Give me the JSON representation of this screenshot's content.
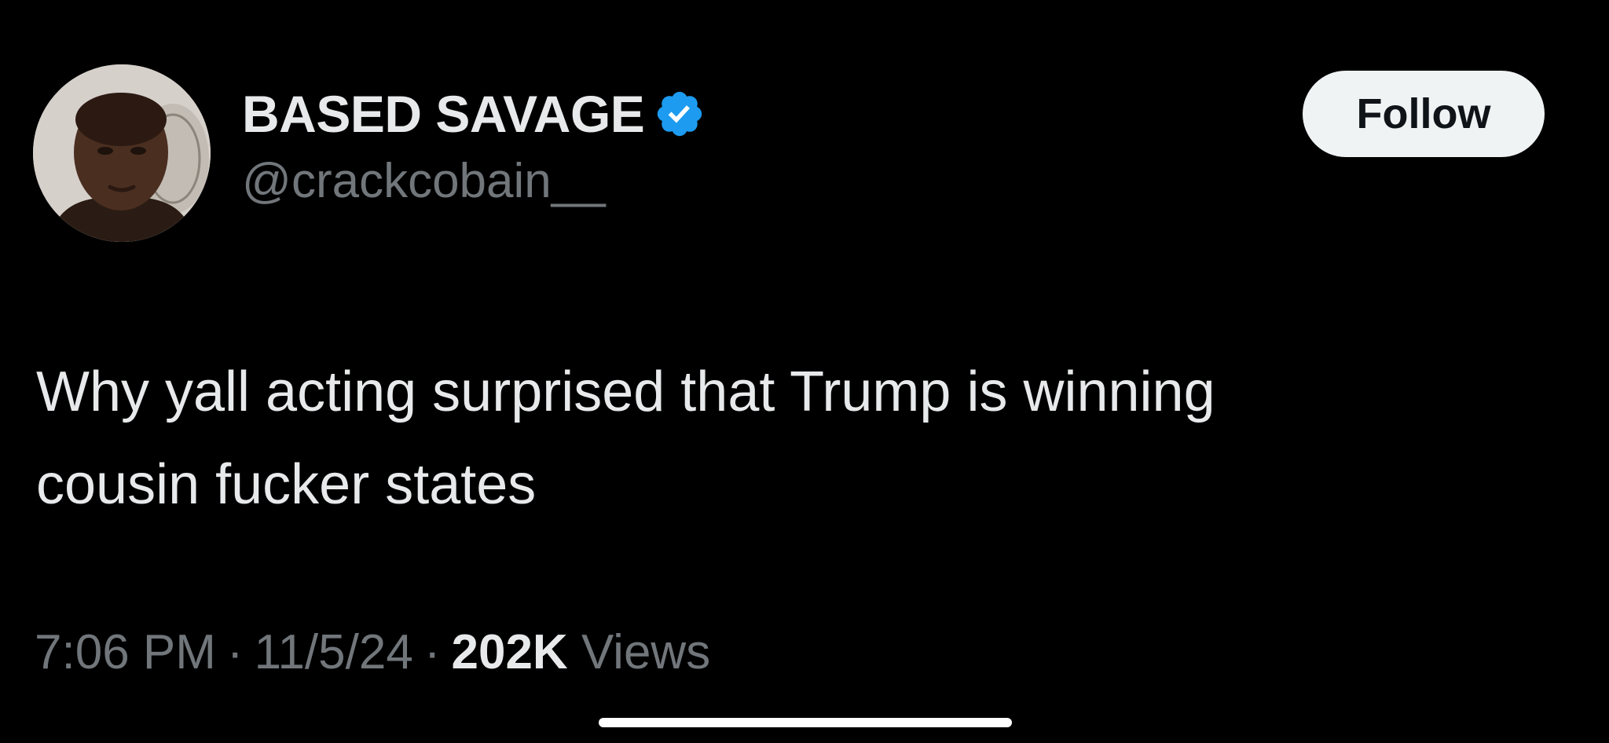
{
  "author": {
    "display_name": "BASED SAVAGE",
    "handle": "@crackcobain__",
    "verified": true,
    "avatar_icon": "profile-photo"
  },
  "follow_label": "Follow",
  "tweet": {
    "text": "Why yall acting surprised that Trump is winning\ncousin fucker states"
  },
  "meta": {
    "time": "7:06 PM",
    "separator": "·",
    "date": "11/5/24",
    "views_count": "202K",
    "views_label": "Views"
  },
  "colors": {
    "background": "#000000",
    "primary_text": "#e7e9ea",
    "secondary_text": "#71767b",
    "verified_blue": "#1d9bf0",
    "follow_bg": "#eff3f4",
    "follow_text": "#0f1419"
  }
}
